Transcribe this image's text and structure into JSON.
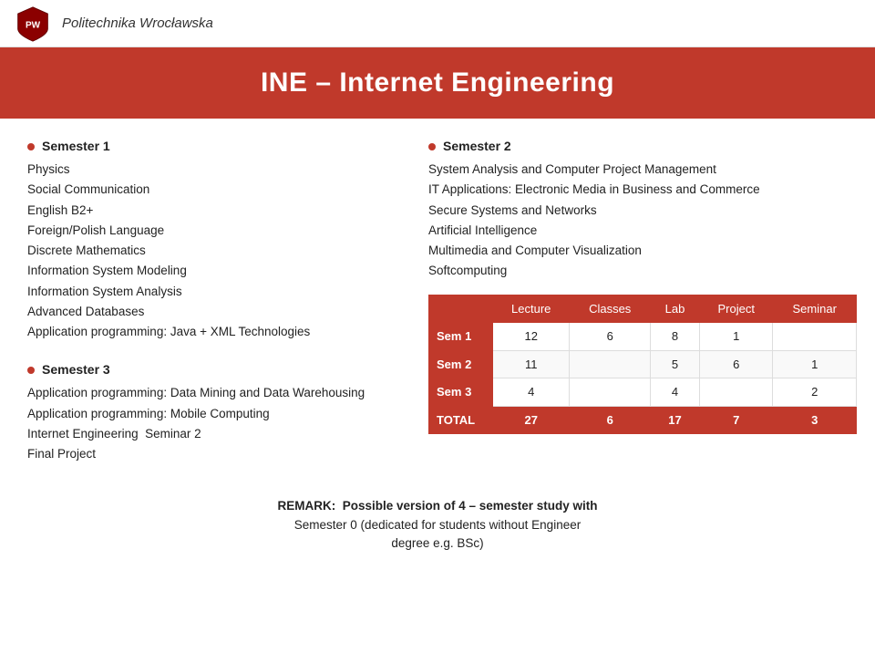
{
  "header": {
    "university": "Politechnika Wrocławska"
  },
  "title": "INE – Internet Engineering",
  "left": {
    "sem1": {
      "label": "Semester 1",
      "items": [
        "Physics",
        "Social Communication",
        "English B2+",
        "Foreign/Polish Language",
        "Discrete Mathematics",
        "Information System Modeling",
        "Information System Analysis",
        "Advanced Databases",
        "Application programming: Java + XML Technologies"
      ]
    },
    "sem3": {
      "label": "Semester 3",
      "items": [
        "Application programming: Data Mining and Data Warehousing",
        "Application programming: Mobile Computing",
        "Internet Engineering  Seminar 2",
        "Final Project"
      ]
    }
  },
  "right": {
    "sem2": {
      "label": "Semester 2",
      "items": [
        "System Analysis and Computer Project Management",
        "IT Applications: Electronic Media in Business and Commerce",
        "Secure Systems and Networks",
        "Artificial Intelligence",
        "Multimedia and Computer Visualization",
        "Softcomputing"
      ]
    },
    "table": {
      "headers": [
        "",
        "Lecture",
        "Classes",
        "Lab",
        "Project",
        "Seminar"
      ],
      "rows": [
        [
          "Sem 1",
          "12",
          "6",
          "8",
          "1",
          ""
        ],
        [
          "Sem 2",
          "11",
          "",
          "5",
          "6",
          "1"
        ],
        [
          "Sem 3",
          "4",
          "",
          "4",
          "",
          "2"
        ],
        [
          "TOTAL",
          "27",
          "6",
          "17",
          "7",
          "3"
        ]
      ]
    }
  },
  "remark": {
    "bold": "REMARK:  Possible version of 4 – semester study with",
    "line2": "Semester 0 (dedicated for students without Engineer",
    "line3": "degree e.g. BSc)"
  }
}
